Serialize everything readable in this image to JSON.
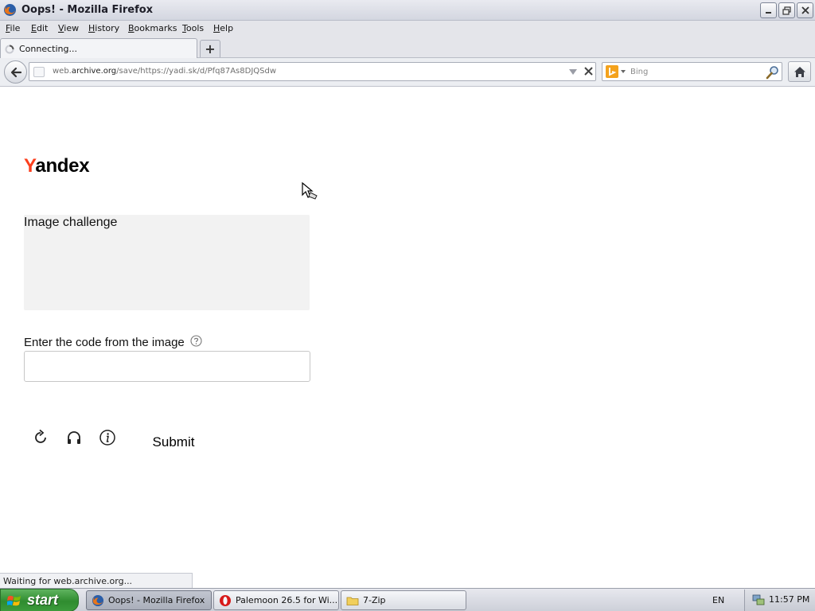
{
  "window": {
    "title": "Oops! - Mozilla Firefox"
  },
  "menu": {
    "items": [
      {
        "first": "F",
        "rest": "ile"
      },
      {
        "first": "E",
        "rest": "dit"
      },
      {
        "first": "V",
        "rest": "iew"
      },
      {
        "first": "H",
        "rest": "istory"
      },
      {
        "first": "B",
        "rest": "ookmarks"
      },
      {
        "first": "T",
        "rest": "ools"
      },
      {
        "first": "H",
        "rest": "elp"
      }
    ]
  },
  "tab": {
    "label": "Connecting...",
    "new_tab_symbol": "+"
  },
  "urlbar": {
    "prefix": "web.",
    "domain": "archive.org",
    "path": "/save/https://yadi.sk/d/Pfq87As8DJQSdw"
  },
  "search": {
    "placeholder": "Bing",
    "engine_icon": "bing-icon"
  },
  "page": {
    "logo_first": "Y",
    "logo_rest": "andex",
    "captcha_label": "Image challenge",
    "code_label": "Enter the code from the image",
    "code_value": "",
    "submit_label": "Submit"
  },
  "status": {
    "text": "Waiting for web.archive.org..."
  },
  "taskbar": {
    "start_label": "start",
    "tasks": [
      {
        "label": "Oops! - Mozilla Firefox",
        "icon": "firefox-icon",
        "active": true
      },
      {
        "label": "Palemoon 26.5 for Wi...",
        "icon": "opera-icon",
        "active": false
      },
      {
        "label": "7-Zip",
        "icon": "folder-icon",
        "active": false
      }
    ],
    "language": "EN",
    "clock": "11:57 PM"
  },
  "colors": {
    "yandex_red": "#fc3f1d",
    "start_green": "#3c9b3c"
  }
}
